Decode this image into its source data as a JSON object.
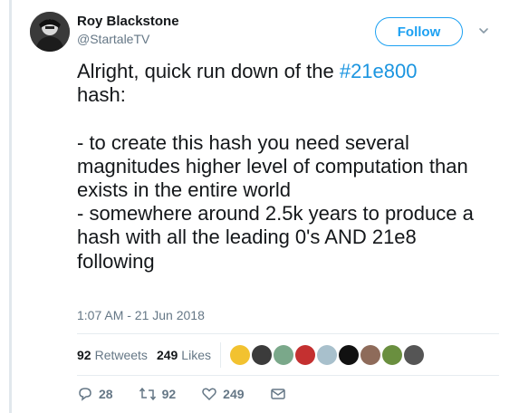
{
  "author": {
    "name": "Roy Blackstone",
    "handle": "@StartaleTV",
    "follow_label": "Follow"
  },
  "tweet": {
    "text_before": "Alright, quick run down of the ",
    "hashtag": "#21e800",
    "text_after": "\nhash:\n\n- to create this hash you need several magnitudes higher level of computation than exists in the entire world\n- somewhere around 2.5k years to produce a hash with all the leading 0's AND 21e8 following",
    "timestamp": "1:07 AM - 21 Jun 2018"
  },
  "stats": {
    "retweets_count": "92",
    "retweets_label": "Retweets",
    "likes_count": "249",
    "likes_label": "Likes"
  },
  "likers": [
    {
      "name": "liker-avatar-1",
      "color": "#f2c230"
    },
    {
      "name": "liker-avatar-2",
      "color": "#3b3b3b"
    },
    {
      "name": "liker-avatar-3",
      "color": "#7aa88a"
    },
    {
      "name": "liker-avatar-4",
      "color": "#c43030"
    },
    {
      "name": "liker-avatar-5",
      "color": "#a8c0cc"
    },
    {
      "name": "liker-avatar-6",
      "color": "#111111"
    },
    {
      "name": "liker-avatar-7",
      "color": "#8e6b5a"
    },
    {
      "name": "liker-avatar-8",
      "color": "#6a8f3f"
    },
    {
      "name": "liker-avatar-9",
      "color": "#555555"
    }
  ],
  "actions": {
    "reply_count": "28",
    "retweet_count": "92",
    "like_count": "249"
  },
  "colors": {
    "accent": "#1da1f2",
    "text": "#14171a",
    "muted": "#657786"
  }
}
